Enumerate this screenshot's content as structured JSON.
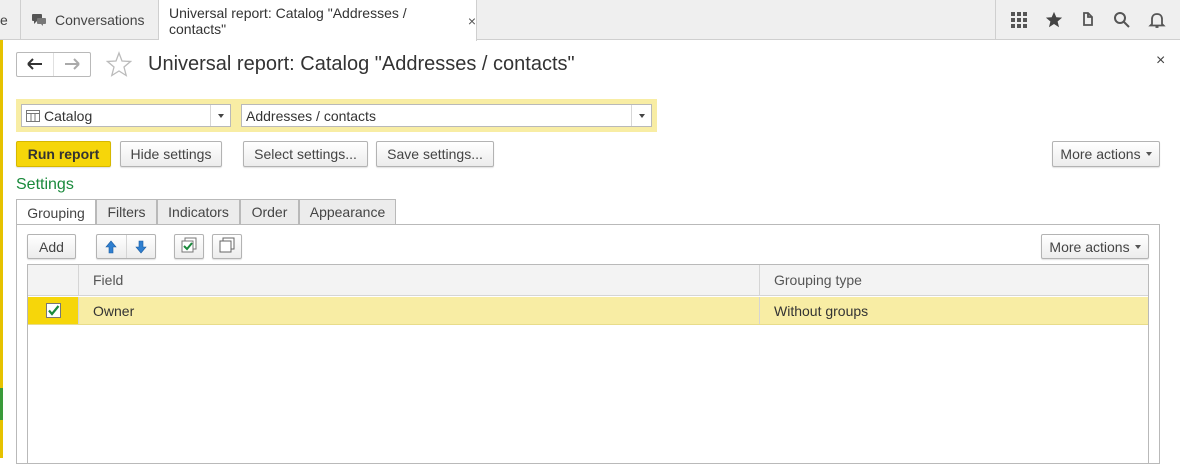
{
  "tabs": {
    "partial_label": "e",
    "conversations_label": "Conversations",
    "active_label": "Universal report: Catalog \"Addresses / contacts\"",
    "close_glyph": "×"
  },
  "top_icons": [
    "apps-grid-icon",
    "star-icon",
    "history-icon",
    "search-icon",
    "bell-icon"
  ],
  "header": {
    "title": "Universal report: Catalog \"Addresses / contacts\"",
    "close_glyph": "×"
  },
  "selectors": {
    "catalog_value": "Catalog",
    "object_value": "Addresses / contacts"
  },
  "toolbar": {
    "run_report": "Run report",
    "hide_settings": "Hide settings",
    "select_settings": "Select settings...",
    "save_settings": "Save settings...",
    "more_actions": "More actions"
  },
  "settings": {
    "title": "Settings",
    "tabs": [
      "Grouping",
      "Filters",
      "Indicators",
      "Order",
      "Appearance"
    ],
    "active_tab": "Grouping",
    "add_label": "Add",
    "more_actions": "More actions"
  },
  "grid": {
    "columns": [
      "Field",
      "Grouping type"
    ],
    "rows": [
      {
        "checked": true,
        "field": "Owner",
        "grouping_type": "Without groups"
      }
    ]
  },
  "colors": {
    "accent_yellow": "#f6d60a",
    "selection_yellow": "#f8eda4",
    "settings_green": "#1a8a3c",
    "arrow_blue": "#2f7fd0"
  }
}
